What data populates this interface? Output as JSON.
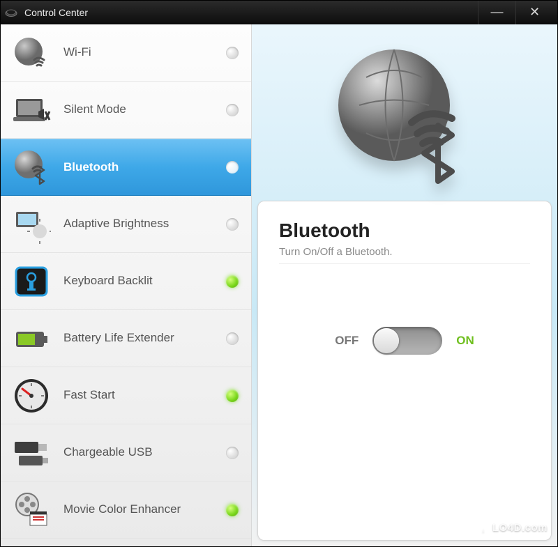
{
  "titlebar": {
    "title": "Control Center",
    "minimize_glyph": "—",
    "close_glyph": "✕"
  },
  "sidebar": {
    "items": [
      {
        "id": "wifi",
        "label": "Wi-Fi",
        "icon": "globe-wifi-icon",
        "on": false,
        "selected": false
      },
      {
        "id": "silent-mode",
        "label": "Silent Mode",
        "icon": "laptop-mute-icon",
        "on": false,
        "selected": false
      },
      {
        "id": "bluetooth",
        "label": "Bluetooth",
        "icon": "globe-bluetooth-icon",
        "on": false,
        "selected": true
      },
      {
        "id": "adaptive-brightness",
        "label": "Adaptive Brightness",
        "icon": "brightness-icon",
        "on": false,
        "selected": false
      },
      {
        "id": "keyboard-backlit",
        "label": "Keyboard Backlit",
        "icon": "keyboard-backlight-icon",
        "on": true,
        "selected": false
      },
      {
        "id": "battery-life-extender",
        "label": "Battery Life Extender",
        "icon": "battery-icon",
        "on": false,
        "selected": false
      },
      {
        "id": "fast-start",
        "label": "Fast Start",
        "icon": "gauge-icon",
        "on": true,
        "selected": false
      },
      {
        "id": "chargeable-usb",
        "label": "Chargeable USB",
        "icon": "usb-icon",
        "on": false,
        "selected": false
      },
      {
        "id": "movie-color-enhancer",
        "label": "Movie Color Enhancer",
        "icon": "movie-icon",
        "on": true,
        "selected": false
      }
    ]
  },
  "detail": {
    "heading": "Bluetooth",
    "subtitle": "Turn On/Off a Bluetooth.",
    "off_label": "OFF",
    "on_label": "ON",
    "toggle_state": "off"
  },
  "watermark": {
    "text": "LO4D.com"
  },
  "colors": {
    "accent_selected": "#3ea8e8",
    "status_on": "#7dd91e"
  }
}
